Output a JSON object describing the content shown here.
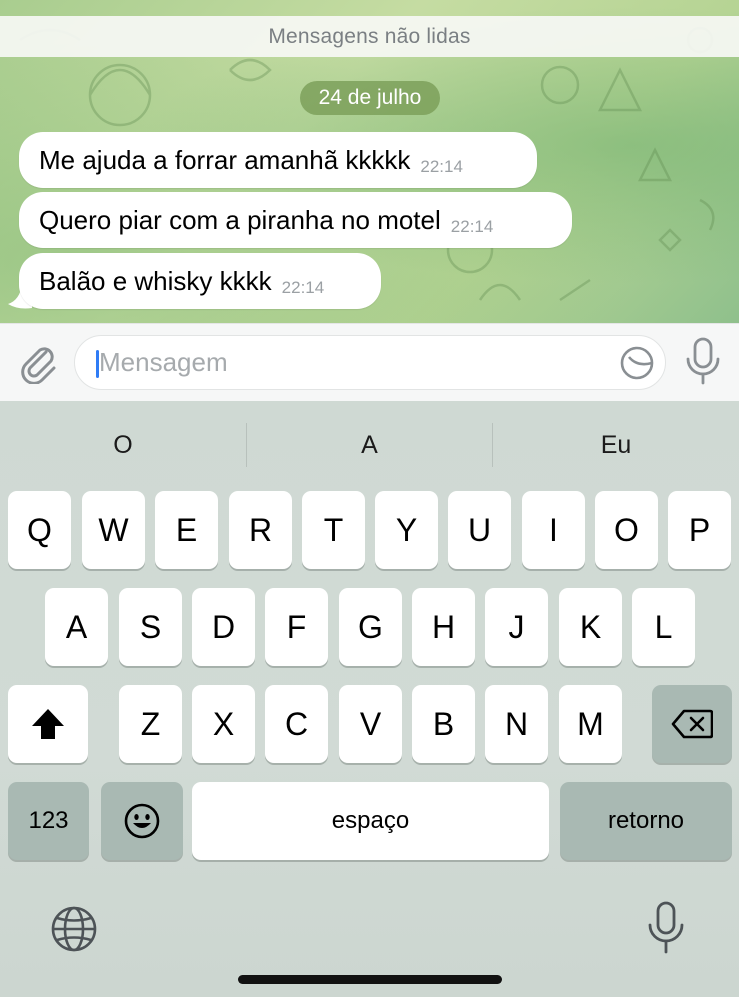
{
  "chat": {
    "unread_label": "Mensagens não lidas",
    "date_label": "24 de julho",
    "messages": [
      {
        "text": "Me ajuda a forrar amanhã kkkkk",
        "time": "22:14"
      },
      {
        "text": "Quero piar com a piranha no motel",
        "time": "22:14"
      },
      {
        "text": "Balão e whisky kkkk",
        "time": "22:14"
      }
    ]
  },
  "input": {
    "placeholder": "Mensagem",
    "attach_icon": "paperclip-icon",
    "sticker_icon": "sticker-icon",
    "mic_icon": "microphone-icon"
  },
  "keyboard": {
    "suggestions": [
      "O",
      "A",
      "Eu"
    ],
    "row1": [
      "Q",
      "W",
      "E",
      "R",
      "T",
      "Y",
      "U",
      "I",
      "O",
      "P"
    ],
    "row2": [
      "A",
      "S",
      "D",
      "F",
      "G",
      "H",
      "J",
      "K",
      "L"
    ],
    "row3": [
      "Z",
      "X",
      "C",
      "V",
      "B",
      "N",
      "M"
    ],
    "numbers_label": "123",
    "space_label": "espaço",
    "return_label": "retorno",
    "shift_icon": "shift-icon",
    "backspace_icon": "backspace-icon",
    "emoji_icon": "emoji-icon",
    "globe_icon": "globe-icon",
    "dictation_icon": "microphone-icon"
  },
  "colors": {
    "accent": "#2f7cf6",
    "date_pill": "#7da05a",
    "chat_bg": "#b6d494"
  }
}
